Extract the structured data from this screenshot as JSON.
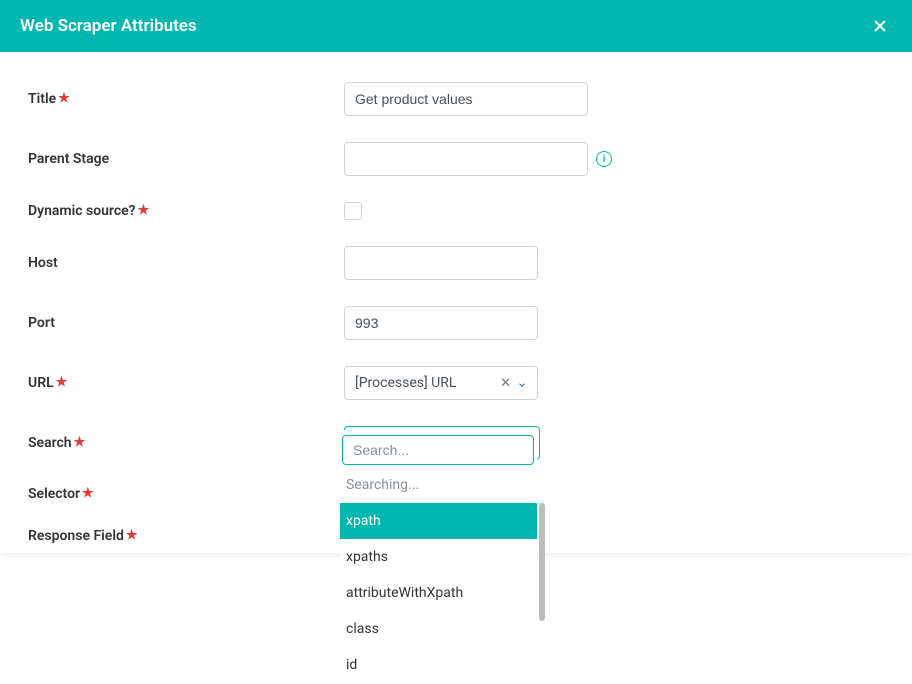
{
  "header": {
    "title": "Web Scraper Attributes"
  },
  "fields": {
    "title": {
      "label": "Title",
      "value": "Get product values",
      "required": true
    },
    "parentStage": {
      "label": "Parent Stage",
      "value": "",
      "required": false
    },
    "dynamicSource": {
      "label": "Dynamic source?",
      "required": true
    },
    "host": {
      "label": "Host",
      "value": "",
      "required": false
    },
    "port": {
      "label": "Port",
      "value": "993",
      "required": false
    },
    "url": {
      "label": "URL",
      "value": "[Processes] URL",
      "required": true
    },
    "search": {
      "label": "Search",
      "value": "xpath",
      "required": true
    },
    "selector": {
      "label": "Selector",
      "required": true
    },
    "responseField": {
      "label": "Response Field",
      "required": true
    }
  },
  "dropdown": {
    "searchPlaceholder": "Search...",
    "status": "Searching...",
    "options": [
      "xpath",
      "xpaths",
      "attributeWithXpath",
      "class",
      "id"
    ],
    "selectedIndex": 0
  }
}
